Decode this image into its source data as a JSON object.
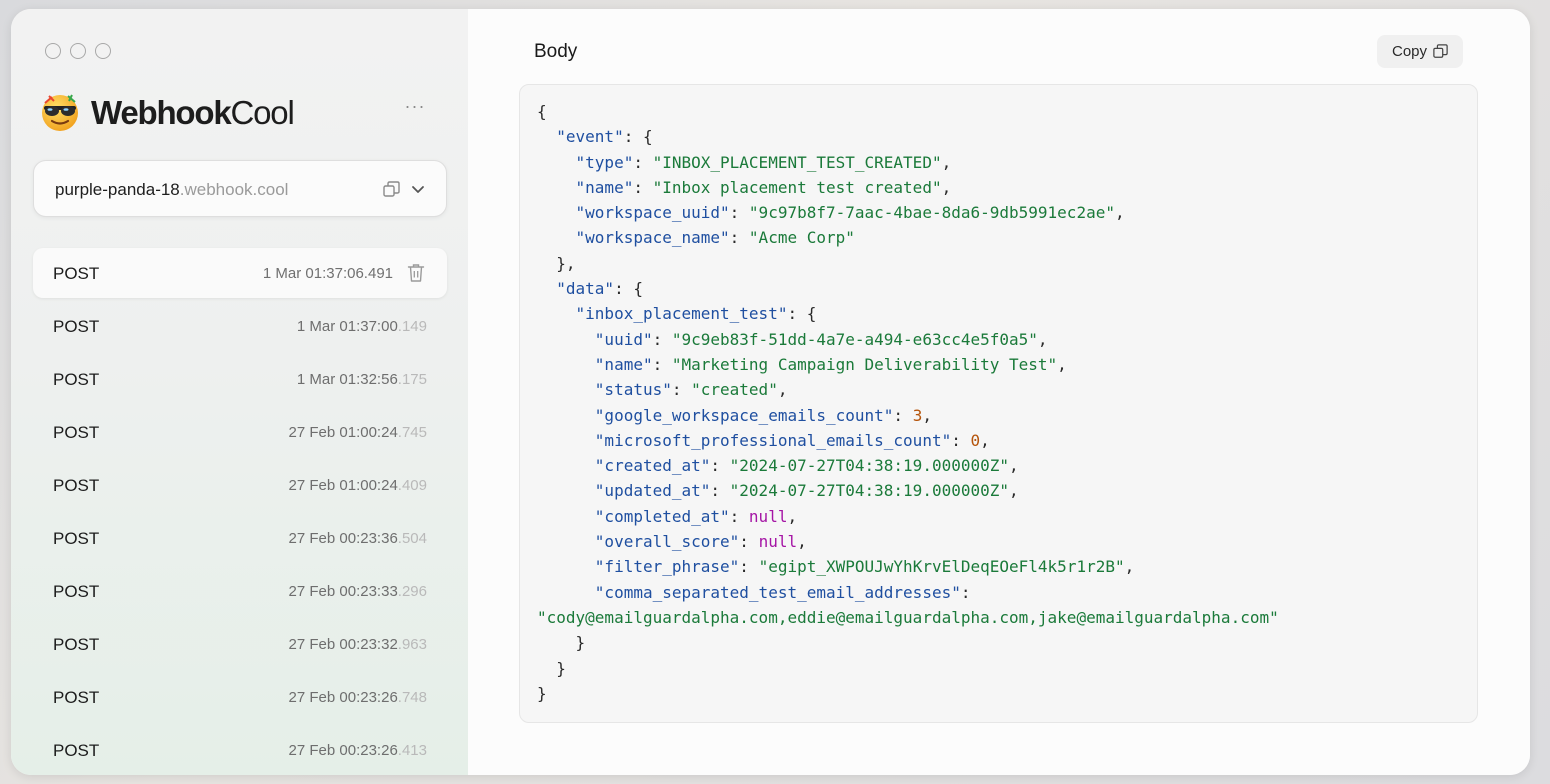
{
  "sidebar": {
    "brand": {
      "bold": "Webhook",
      "light": "Cool"
    },
    "url": {
      "prefix": "purple-panda-18",
      "domain": ".webhook.cool"
    },
    "requests": [
      {
        "method": "POST",
        "time": "1 Mar 01:37:06.491",
        "selected": true
      },
      {
        "method": "POST",
        "time_main": "1 Mar 01:37:00",
        "time_ms": ".149"
      },
      {
        "method": "POST",
        "time_main": "1 Mar 01:32:56",
        "time_ms": ".175"
      },
      {
        "method": "POST",
        "time_main": "27 Feb 01:00:24",
        "time_ms": ".745"
      },
      {
        "method": "POST",
        "time_main": "27 Feb 01:00:24",
        "time_ms": ".409"
      },
      {
        "method": "POST",
        "time_main": "27 Feb 00:23:36",
        "time_ms": ".504"
      },
      {
        "method": "POST",
        "time_main": "27 Feb 00:23:33",
        "time_ms": ".296"
      },
      {
        "method": "POST",
        "time_main": "27 Feb 00:23:32",
        "time_ms": ".963"
      },
      {
        "method": "POST",
        "time_main": "27 Feb 00:23:26",
        "time_ms": ".748"
      },
      {
        "method": "POST",
        "time_main": "27 Feb 00:23:26",
        "time_ms": ".413"
      }
    ]
  },
  "main": {
    "title": "Body",
    "copy_label": "Copy",
    "body": {
      "event": {
        "type": "INBOX_PLACEMENT_TEST_CREATED",
        "name": "Inbox placement test created",
        "workspace_uuid": "9c97b8f7-7aac-4bae-8da6-9db5991ec2ae",
        "workspace_name": "Acme Corp"
      },
      "data": {
        "inbox_placement_test": {
          "uuid": "9c9eb83f-51dd-4a7e-a494-e63cc4e5f0a5",
          "name": "Marketing Campaign Deliverability Test",
          "status": "created",
          "google_workspace_emails_count": 3,
          "microsoft_professional_emails_count": 0,
          "created_at": "2024-07-27T04:38:19.000000Z",
          "updated_at": "2024-07-27T04:38:19.000000Z",
          "completed_at": null,
          "overall_score": null,
          "filter_phrase": "egipt_XWPOUJwYhKrvElDeqEOeFl4k5r1r2B",
          "comma_separated_test_email_addresses": "cody@emailguardalpha.com,eddie@emailguardalpha.com,jake@emailguardalpha.com"
        }
      }
    }
  },
  "colors": {
    "json_key": "#1f4fa0",
    "json_string": "#1b7a3a",
    "json_number": "#b5540b",
    "json_null": "#a515a5"
  }
}
